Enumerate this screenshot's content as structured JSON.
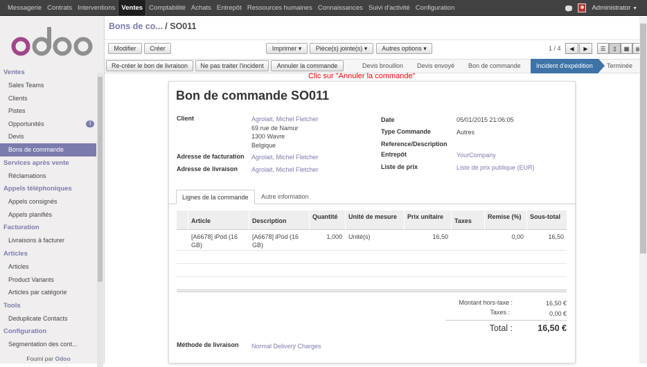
{
  "topbar": {
    "menu": [
      "Messagerie",
      "Contrats",
      "Interventions",
      "Ventes",
      "Comptabilité",
      "Achats",
      "Entrepôt",
      "Ressources humaines",
      "Connaissances",
      "Suivi d'activité",
      "Configuration"
    ],
    "user": "Administrator"
  },
  "sidebar": {
    "sections": [
      {
        "title": "Ventes",
        "items": [
          "Sales Teams",
          "Clients",
          "Pistes",
          "Opportunités",
          "Devis",
          "Bons de commande"
        ]
      },
      {
        "title": "Services après vente",
        "items": [
          "Réclamations"
        ]
      },
      {
        "title": "Appels téléphoniques",
        "items": [
          "Appels consignés",
          "Appels planifiés"
        ]
      },
      {
        "title": "Facturation",
        "items": [
          "Livraisons à facturer"
        ]
      },
      {
        "title": "Articles",
        "items": [
          "Articles",
          "Product Variants",
          "Articles par catégorie"
        ]
      },
      {
        "title": "Tools",
        "items": [
          "Deduplicate Contacts"
        ]
      },
      {
        "title": "Configuration",
        "items": [
          "Segmentation des cont..."
        ]
      }
    ],
    "opportunities_badge": "1",
    "powered_prefix": "Fourni par",
    "powered_brand": "Odoo"
  },
  "breadcrumb": {
    "parent": "Bons de co...",
    "sep": "/",
    "current": "SO011"
  },
  "toolbar": {
    "edit": "Modifier",
    "create": "Créer",
    "print": "Imprimer",
    "attachments": "Pièce(s) jointe(s)",
    "more": "Autres options",
    "pager": "1 / 4"
  },
  "actions": {
    "recreate": "Re-créer le bon de livraison",
    "ignore": "Ne pas traiter l'incident",
    "cancel": "Annuler la commande"
  },
  "statusbar": {
    "steps": [
      "Devis brouillon",
      "Devis envoyé",
      "Bon de commande",
      "Incident d'expédition",
      "Terminée"
    ],
    "active": "Incident d'expédition"
  },
  "annotation": "Clic sur \"Annuler la commande\"",
  "document": {
    "title": "Bon de commande SO011",
    "client_label": "Client",
    "client_name": "Agrolait, Michel Fletcher",
    "address1": "69 rue de Namur",
    "address2": "1300 Wavre",
    "address3": "Belgique",
    "invoice_label": "Adresse de facturation",
    "invoice_value": "Agrolait, Michel Fletcher",
    "delivery_label": "Adresse de livraison",
    "delivery_value": "Agrolait, Michel Fletcher",
    "date_label": "Date",
    "date_value": "05/01/2015 21:06:05",
    "type_label": "Type Commande",
    "type_value": "Autres",
    "ref_label": "Reference/Description",
    "warehouse_label": "Entrepôt",
    "warehouse_value": "YourCompany",
    "pricelist_label": "Liste de prix",
    "pricelist_value": "Liste de prix publique (EUR)"
  },
  "tabs": [
    "Lignes de la commande",
    "Autre information"
  ],
  "table": {
    "headers": [
      "Article",
      "Description",
      "Quantité",
      "Unité de mesure",
      "Prix unitaire",
      "Taxes",
      "Remise (%)",
      "Sous-total"
    ],
    "rows": [
      {
        "article": "[A6678] iPod (16 GB)",
        "description": "[A6678] iPod (16 GB)",
        "qty": "1,000",
        "uom": "Unité(s)",
        "price": "16,50",
        "taxes": "",
        "discount": "0,00",
        "subtotal": "16,50"
      }
    ]
  },
  "totals": {
    "untaxed_label": "Montant hors-taxe :",
    "untaxed_value": "16,50 €",
    "taxes_label": "Taxes :",
    "taxes_value": "0,00 €",
    "total_label": "Total :",
    "total_value": "16,50 €"
  },
  "delivery_method": {
    "label": "Méthode de livraison",
    "value": "Normal Delivery Charges"
  }
}
